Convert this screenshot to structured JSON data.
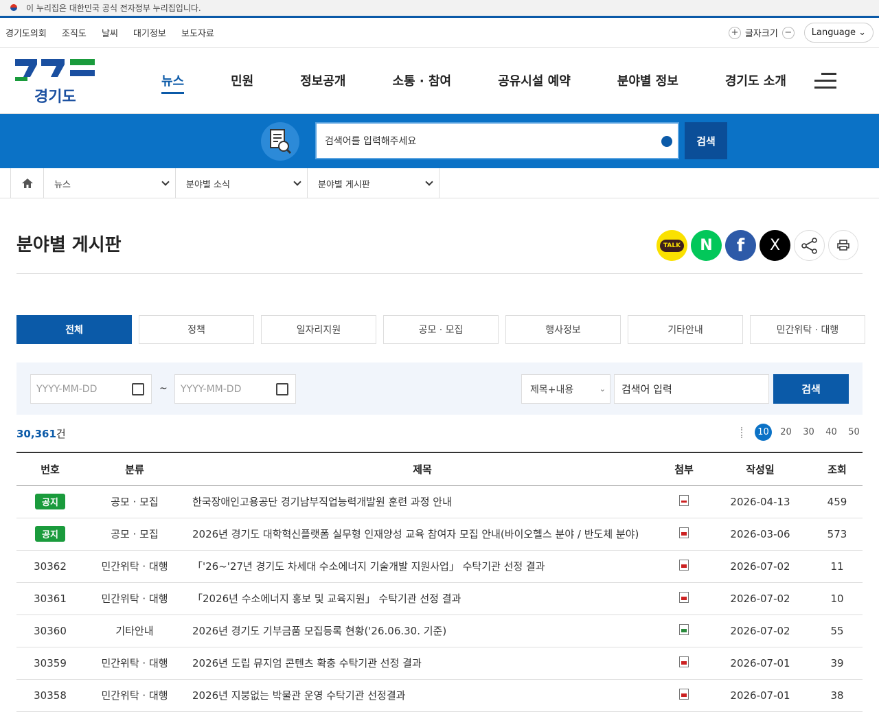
{
  "govbar": {
    "text": "이 누리집은 대한민국 공식 전자정부 누리집입니다."
  },
  "util": {
    "links": [
      "경기도의회",
      "조직도",
      "날씨",
      "대기정보",
      "보도자료"
    ],
    "fontsize_label": "글자크기",
    "language_label": "Language"
  },
  "logo": {
    "text": "경기도",
    "colors": [
      "#1a4fa0",
      "#1a9b3c"
    ]
  },
  "gnb": {
    "items": [
      "뉴스",
      "민원",
      "정보공개",
      "소통 · 참여",
      "공유시설 예약",
      "분야별 정보",
      "경기도 소개"
    ]
  },
  "search": {
    "placeholder": "검색어를 입력해주세요",
    "button": "검색"
  },
  "breadcrumb": {
    "segments": [
      "뉴스",
      "분야별 소식",
      "분야별 게시판"
    ]
  },
  "page": {
    "title": "분야별 게시판"
  },
  "share": {
    "kakao": "TALK",
    "naver": "N",
    "facebook": "f",
    "x": "X"
  },
  "tabs": [
    "전체",
    "정책",
    "일자리지원",
    "공모 · 모집",
    "행사정보",
    "기타안내",
    "민간위탁 · 대행"
  ],
  "filter": {
    "date_placeholder_start": "YYYY-MM-DD",
    "date_placeholder_end": "YYYY-MM-DD",
    "tilde": "~",
    "select_value": "제목+내용",
    "keyword_placeholder": "검색어 입력",
    "button": "검색"
  },
  "list": {
    "count_number": "30,361",
    "count_unit": "건",
    "per_page_options": [
      "10",
      "20",
      "30",
      "40",
      "50"
    ],
    "per_page_selected": "10",
    "headers": [
      "번호",
      "분류",
      "제목",
      "첨부",
      "작성일",
      "조회"
    ],
    "rows": [
      {
        "no": "공지",
        "notice": true,
        "category": "공모 · 모집",
        "title": "한국장애인고용공단 경기남부직업능력개발원 훈련 과정 안내",
        "file": "png",
        "date": "2026-04-13",
        "views": "459"
      },
      {
        "no": "공지",
        "notice": true,
        "category": "공모 · 모집",
        "title": "2026년 경기도 대학혁신플랫폼 실무형 인재양성 교육 참여자 모집 안내(바이오헬스 분야 / 반도체 분야)",
        "file": "pdf",
        "date": "2026-03-06",
        "views": "573"
      },
      {
        "no": "30362",
        "notice": false,
        "category": "민간위탁 · 대행",
        "title": "「'26~'27년 경기도 차세대 수소에너지 기술개발 지원사업」 수탁기관 선정 결과",
        "file": "pdf",
        "date": "2026-07-02",
        "views": "11"
      },
      {
        "no": "30361",
        "notice": false,
        "category": "민간위탁 · 대행",
        "title": "「2026년 수소에너지 홍보 및 교육지원」 수탁기관 선정 결과",
        "file": "pdf",
        "date": "2026-07-02",
        "views": "10"
      },
      {
        "no": "30360",
        "notice": false,
        "category": "기타안내",
        "title": "2026년 경기도 기부금품 모집등록 현황('26.06.30. 기준)",
        "file": "xls",
        "date": "2026-07-02",
        "views": "55"
      },
      {
        "no": "30359",
        "notice": false,
        "category": "민간위탁 · 대행",
        "title": "2026년 도립 뮤지엄 콘텐츠 확충 수탁기관 선정 결과",
        "file": "pdf",
        "date": "2026-07-01",
        "views": "39"
      },
      {
        "no": "30358",
        "notice": false,
        "category": "민간위탁 · 대행",
        "title": "2026년 지붕없는 박물관 운영 수탁기관 선정결과",
        "file": "pdf",
        "date": "2026-07-01",
        "views": "38"
      }
    ]
  }
}
